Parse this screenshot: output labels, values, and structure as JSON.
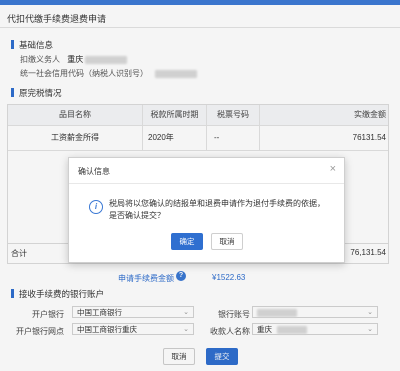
{
  "page": {
    "title": "代扣代缴手续费退费申请"
  },
  "basic_info": {
    "section_title": "基础信息",
    "withholder_label": "扣缴义务人",
    "withholder_value": "重庆",
    "credit_code_label": "统一社会信用代码（纳税人识别号）"
  },
  "tax_table": {
    "section_title": "原完税情况",
    "headers": [
      "品目名称",
      "税款所属时期",
      "税票号码",
      "实缴金额"
    ],
    "rows": [
      {
        "item": "工资薪金所得",
        "period": "2020年",
        "ticket": "--",
        "amount": "76131.54"
      }
    ],
    "total_label": "合计",
    "total_amount": "76,131.54"
  },
  "fee": {
    "label": "申请手续费金额",
    "value": "¥1522.63"
  },
  "bank": {
    "section_title": "接收手续费的银行账户",
    "open_bank_label": "开户银行",
    "open_bank_value": "中国工商银行",
    "account_label": "银行账号",
    "branch_label": "开户银行网点",
    "branch_value": "中国工商银行重庆",
    "payee_label": "收款人名称",
    "payee_value": "重庆"
  },
  "footer": {
    "cancel_label": "取消",
    "submit_label": "提交"
  },
  "dialog": {
    "title": "确认信息",
    "message": "税局将以您确认的结报单和退费申请作为退付手续费的依据，是否确认提交？",
    "confirm_label": "确定",
    "cancel_label": "取消"
  },
  "colors": {
    "accent": "#2f6fd0",
    "header_bar": "#3d7ad6"
  },
  "icons": {
    "dialog_info": "info-circle-icon",
    "help": "question-circle-icon",
    "close": "close-icon",
    "dropdown": "chevron-down-icon"
  }
}
